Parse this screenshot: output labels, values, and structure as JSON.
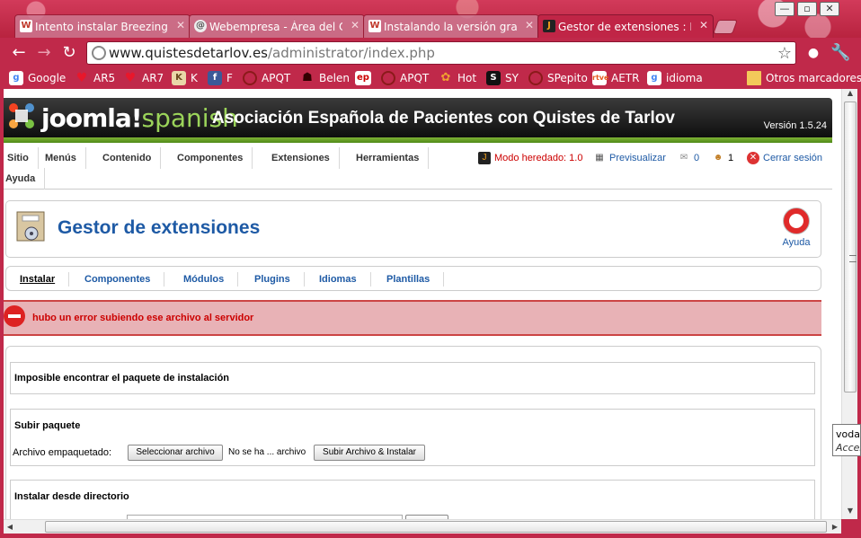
{
  "browser": {
    "tabs": [
      {
        "title": "Intento instalar Breezing F",
        "favicon": "W",
        "favicon_color": "#c0392b",
        "state": "inactive"
      },
      {
        "title": "Webempresa - Área del Clie",
        "favicon": "@",
        "favicon_color": "#666666",
        "state": "inactive"
      },
      {
        "title": "Instalando la versión gratuit",
        "favicon": "W",
        "favicon_color": "#c0392b",
        "state": "inactive"
      },
      {
        "title": "Gestor de extensiones : Insta",
        "favicon": "J",
        "favicon_color": "#f4a01c",
        "state": "active"
      }
    ],
    "url_host": "www.quistesdetarlov.es",
    "url_path": "/administrator/index.php",
    "bookmarks": [
      {
        "label": "Google",
        "icon": "google-icon",
        "color": "#4285f4"
      },
      {
        "label": "AR5",
        "icon": "heart-icon",
        "color": "#e8172b"
      },
      {
        "label": "AR7",
        "icon": "heart-icon",
        "color": "#e8172b"
      },
      {
        "label": "K",
        "icon": "k-icon",
        "color": "#6b4a1f"
      },
      {
        "label": "F",
        "icon": "facebook-icon",
        "color": "#3b5998"
      },
      {
        "label": "APQT",
        "icon": "apqt-icon",
        "color": "#c0392b"
      },
      {
        "label": "Belen",
        "icon": "hat-icon",
        "color": "#a01515"
      },
      {
        "label": "",
        "icon": "ep-icon",
        "color": "#ffffff"
      },
      {
        "label": "APQT",
        "icon": "apqt-icon",
        "color": "#c0392b"
      },
      {
        "label": "Hot",
        "icon": "butterfly-icon",
        "color": "#f0a030"
      },
      {
        "label": "SY",
        "icon": "sy-icon",
        "color": "#111111"
      },
      {
        "label": "SPepito",
        "icon": "apqt-icon",
        "color": "#c0392b"
      },
      {
        "label": "AETR",
        "icon": "rtve-icon",
        "color": "#e65a1e"
      },
      {
        "label": "idioma",
        "icon": "google-icon",
        "color": "#4285f4"
      }
    ],
    "other_bookmarks": "Otros marcadores",
    "tooltip_line1": "voda",
    "tooltip_line2": "Acces"
  },
  "joomla": {
    "logo_main": "joomla!",
    "logo_sub": "spanish",
    "site_name": "Asociación Española de Pacientes con Quistes de Tarlov",
    "version": "Versión 1.5.24",
    "menu": [
      "Sitio",
      "Menús",
      "Contenido",
      "Componentes",
      "Extensiones",
      "Herramientas",
      "Ayuda"
    ],
    "status": {
      "legacy_mode": "Modo heredado: 1.0",
      "preview": "Previsualizar",
      "messages": "0",
      "users": "1",
      "logout": "Cerrar sesión"
    },
    "page_title": "Gestor de extensiones",
    "help": "Ayuda",
    "subtabs": [
      "Instalar",
      "Componentes",
      "Módulos",
      "Plugins",
      "Idiomas",
      "Plantillas"
    ],
    "error": "hubo un error subiendo ese archivo al servidor",
    "package_notice": "Imposible encontrar el paquete de instalación",
    "upload": {
      "legend": "Subir paquete",
      "label": "Archivo empaquetado:",
      "choose_button": "Seleccionar archivo",
      "no_file": "No se ha ... archivo",
      "submit": "Subir Archivo & Instalar"
    },
    "directory": {
      "legend": "Instalar desde directorio"
    },
    "colors": {
      "link_blue": "#1e5aa5",
      "error_red": "#cc0000",
      "error_bg": "#e8b2b6",
      "chrome_theme": "#c0294a"
    }
  }
}
